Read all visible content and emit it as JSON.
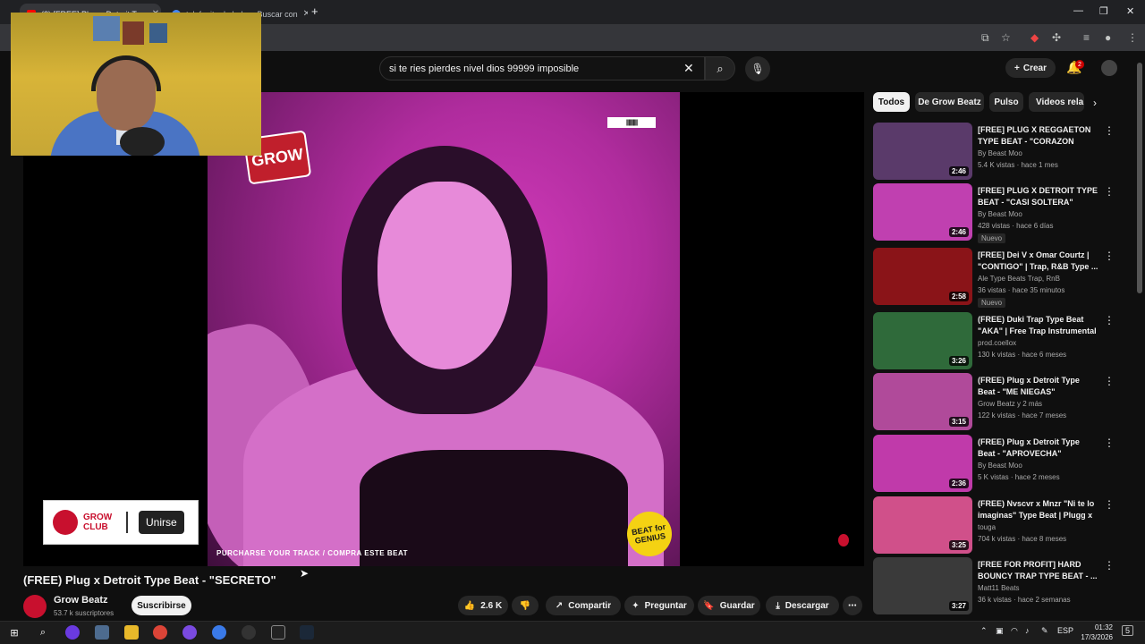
{
  "browser": {
    "tabs": [
      {
        "label": "(2) [FREE] Plug x Detroit Ty..."
      },
      {
        "label": "telefonito de bebe - Buscar con"
      }
    ],
    "new_tab": "+"
  },
  "header": {
    "search_query": "si te ries pierdes nivel dios 99999 imposible",
    "create_label": "Crear",
    "notif_count": "2"
  },
  "player": {
    "logo_text": "GROW",
    "barcode_text": "|||||||||||||||",
    "purchase_text": "PURCHARSE YOUR TRACK / COMPRA ESTE BEAT",
    "badge_text": "BEAT for GENIUS",
    "grow_club_text": "GROW CLUB",
    "join_label": "Unirse"
  },
  "video": {
    "title": "(FREE) Plug x Detroit Type Beat - \"SECRETO\"",
    "channel": "Grow Beatz",
    "subs": "53.7 k suscriptores",
    "subscribe_label": "Suscribirse",
    "likes": "2.6 K",
    "share_label": "Compartir",
    "ask_label": "Preguntar",
    "save_label": "Guardar",
    "download_label": "Descargar"
  },
  "chips": [
    {
      "label": "Todos"
    },
    {
      "label": "De Grow Beatz"
    },
    {
      "label": "Pulso"
    },
    {
      "label": "Videos rela"
    }
  ],
  "recommendations": [
    {
      "title": "[FREE] PLUG X REGGAETON TYPE BEAT - \"CORAZON ROTO\"",
      "channel": "By Beast Moo",
      "meta": "5.4 K vistas · hace 1 mes",
      "duration": "2:46",
      "badge": "",
      "color": "#5a3a6a"
    },
    {
      "title": "[FREE] PLUG X DETROIT TYPE BEAT - \"CASI SOLTERA\"",
      "channel": "By Beast Moo",
      "meta": "428 vistas · hace 6 días",
      "duration": "2:46",
      "badge": "Nuevo",
      "color": "#c040b0"
    },
    {
      "title": "[FREE] Dei V x Omar Courtz | \"CONTIGO\" | Trap, R&B Type ...",
      "channel": "Ale Type Beats Trap, RnB",
      "meta": "36 vistas · hace 35 minutos",
      "duration": "2:58",
      "badge": "Nuevo",
      "color": "#8a1418"
    },
    {
      "title": "(FREE) Duki Trap Type Beat \"AKA\" | Free Trap Instrumental ...",
      "channel": "prod.coellox",
      "meta": "130 k vistas · hace 6 meses",
      "duration": "3:26",
      "badge": "",
      "color": "#2f6a3a"
    },
    {
      "title": "(FREE) Plug x Detroit Type Beat - \"ME NIEGAS\"",
      "channel": "Grow Beatz y 2 más",
      "meta": "122 k vistas · hace 7 meses",
      "duration": "3:15",
      "badge": "",
      "color": "#b04a9a"
    },
    {
      "title": "(FREE) Plug x Detroit Type Beat - \"APROVECHA\"",
      "channel": "By Beast Moo",
      "meta": "5 K vistas · hace 2 meses",
      "duration": "2:36",
      "badge": "",
      "color": "#c03aaa"
    },
    {
      "title": "(FREE) Nvscvr x Mnzr \"Ni te lo imaginas\" Type Beat | Plugg x ...",
      "channel": "touga",
      "meta": "704 k vistas · hace 8 meses",
      "duration": "3:25",
      "badge": "",
      "color": "#d0508a"
    },
    {
      "title": "[FREE FOR PROFIT] HARD BOUNCY TRAP TYPE BEAT - ...",
      "channel": "Matt11 Beats",
      "meta": "36 k vistas · hace 2 semanas",
      "duration": "3:27",
      "badge": "",
      "color": "#3a3a3a"
    }
  ],
  "taskbar": {
    "lang": "ESP",
    "time": "01:32",
    "date": "17/3/2026",
    "notif": "5"
  }
}
